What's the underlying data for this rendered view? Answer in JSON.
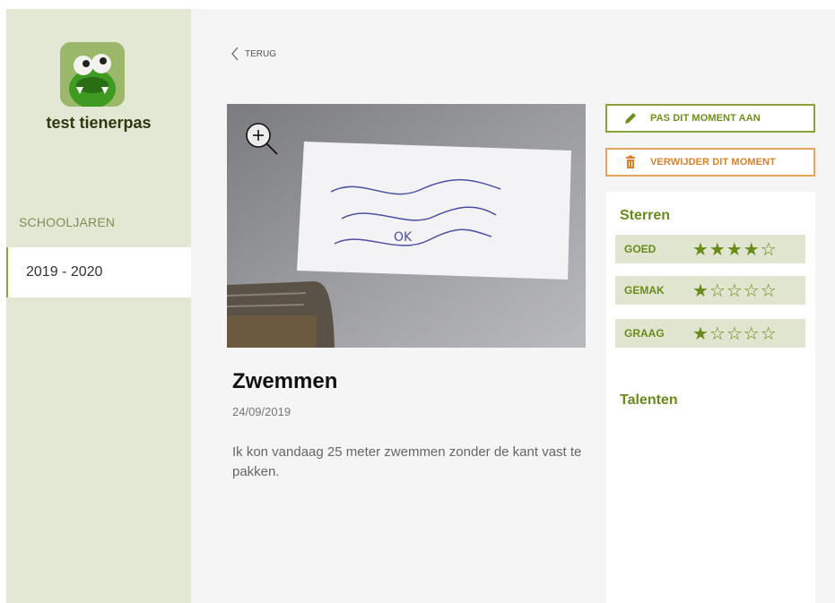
{
  "sidebar": {
    "profile_name": "test tienerpas",
    "section_label": "SCHOOLJAREN",
    "years": [
      "2019 - 2020"
    ]
  },
  "nav": {
    "back_label": "TERUG"
  },
  "moment": {
    "title": "Zwemmen",
    "date": "24/09/2019",
    "description": "Ik kon vandaag 25 meter zwemmen zonder de kant vast te pakken."
  },
  "photo": {
    "handwriting": "OK"
  },
  "actions": {
    "edit_label": "PAS DIT MOMENT AAN",
    "delete_label": "VERWIJDER DIT MOMENT"
  },
  "ratings": {
    "heading": "Sterren",
    "items": [
      {
        "label": "GOED",
        "stars": "★★★★☆",
        "value": 4,
        "max": 5
      },
      {
        "label": "GEMAK",
        "stars": "★☆☆☆☆",
        "value": 1,
        "max": 5
      },
      {
        "label": "GRAAG",
        "stars": "★☆☆☆☆",
        "value": 1,
        "max": 5
      }
    ]
  },
  "talents": {
    "heading": "Talenten"
  },
  "colors": {
    "accent": "#6a8a1c",
    "danger": "#d9822b",
    "sidebar": "#e2e8d4"
  }
}
